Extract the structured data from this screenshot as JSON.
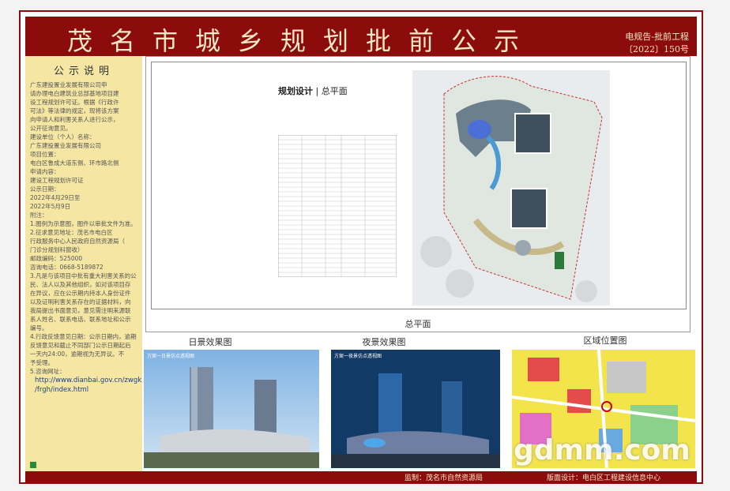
{
  "header": {
    "title": "茂名市城乡规划批前公示",
    "doc_no_line1": "电规告-批前工程",
    "doc_no_line2": "〔2022〕150号"
  },
  "notice": {
    "title": "公示说明",
    "lines": [
      "广东建投置业发展有限公司申",
      "请办理电白建筑业总部基地项目建",
      "设工程规划许可证。根据《行政许",
      "可法》等法律的规定，现将该方案",
      "向申请人和利害关系人进行公示，",
      "公开征询意见。",
      "建设单位（个人）名称：",
      "广东建投置业发展有限公司",
      "项目位置：",
      "电白区鲁成大道东侧、环市路北侧",
      "申请内容：",
      "建设工程规划许可证",
      "公示日期：",
      "2022年4月29日至",
      "2022年5月9日",
      "附注：",
      "1.图例为示意图，图件以审批文件为准。",
      "2.征求意见地址：茂名市电白区",
      "行政服务中心人民政府自然资源局（",
      "门诊分规划科窗收）",
      "邮政编码：525000",
      "咨询电话：0668-5189872",
      "3.凡是与该项目中批有重大利害关系的公",
      "民、法人以及其他组织，如对该项目存",
      "在异议，应在公示期内持本人身份证件",
      "以及证明利害关系存在的证据材料，向",
      "我局提出书面意见，意见需注明来源联",
      "系人姓名、联系电话、联系地址和公示",
      "编号。",
      "4.行政反馈意见日期：公示日期内，逾期",
      "反馈意见和截止不同部门公示日期起后",
      "一天内24:00，逾期视为无异议。不",
      "予受理。",
      "5.咨询网址："
    ],
    "link_line1": "http://www.dianbai.gov.cn/zwgk",
    "link_line2": "/frgh/index.html"
  },
  "plan": {
    "heading": "规划设计",
    "heading_sub": "总平面",
    "label": "总平面"
  },
  "captions": {
    "day": "日景效果图",
    "night": "夜景效果图",
    "location": "区域位置图"
  },
  "panel_caption": {
    "day": "方案一日景仿点透视图",
    "night": "方案一夜景仿点透视图"
  },
  "footer": {
    "supervisor": "监制：茂名市自然资源局",
    "design": "版面设计：电白区工程建设信息中心"
  },
  "watermark": "gdmm.com",
  "colors": {
    "brand": "#8c0b0b",
    "notice_bg": "#f5e7a3"
  }
}
